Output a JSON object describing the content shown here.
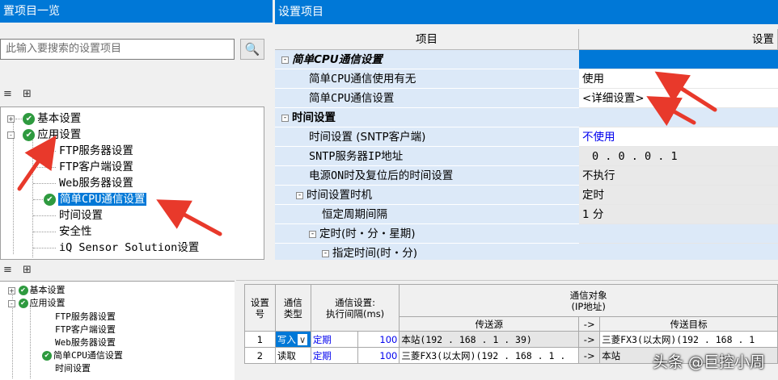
{
  "left_panel": {
    "title": "置项目一览",
    "search_placeholder": "此输入要搜索的设置项目",
    "search_icon": "binoculars-icon",
    "toolbar_icons": [
      "sort-icon",
      "tree-expand-icon"
    ],
    "tree": {
      "basic": "基本设置",
      "application": "应用设置",
      "children": [
        "FTP服务器设置",
        "FTP客户端设置",
        "Web服务器设置",
        "简单CPU通信设置",
        "时间设置",
        "安全性",
        "iQ Sensor Solution设置"
      ]
    }
  },
  "right_panel": {
    "title": "设置项目",
    "col_item": "项目",
    "col_setting": "设置",
    "rows": [
      {
        "name": "简单CPU通信设置",
        "value": ""
      },
      {
        "name": "简单CPU通信使用有无",
        "value": "使用"
      },
      {
        "name": "简单CPU通信设置",
        "value": "<详细设置>"
      },
      {
        "name": "时间设置",
        "value": ""
      },
      {
        "name": "时间设置 (SNTP客户端)",
        "value": "不使用"
      },
      {
        "name": "SNTP服务器IP地址",
        "value": "0 .  0 .  0 .  1"
      },
      {
        "name": "电源ON时及复位后的时间设置",
        "value": "不执行"
      },
      {
        "name": "时间设置时机",
        "value": "定时"
      },
      {
        "name": "恒定周期间隔",
        "value": "1 分"
      },
      {
        "name": "定时(时・分・星期)",
        "value": ""
      },
      {
        "name": "指定时间(时・分)",
        "value": ""
      }
    ]
  },
  "bottom_left": {
    "tree": {
      "basic": "基本设置",
      "application": "应用设置",
      "children": [
        "FTP服务器设置",
        "FTP客户端设置",
        "Web服务器设置",
        "简单CPU通信设置",
        "时间设置"
      ]
    }
  },
  "bottom_right": {
    "headers": {
      "setting_no": "设置\n号",
      "comm_type": "通信\n类型",
      "comm_setting": "通信设置:\n执行间隔(ms)",
      "target": "通信对象\n(IP地址)",
      "source": "传送源",
      "arrow": "->",
      "dest": "传送目标"
    },
    "rows": [
      {
        "no": "1",
        "type": "写入",
        "timing": "定期",
        "interval": "100",
        "source": "本站(192 . 168 .  1 . 39)",
        "arrow": "->",
        "dest": "三菱FX3(以太网)(192 . 168 .  1"
      },
      {
        "no": "2",
        "type": "读取",
        "timing": "定期",
        "interval": "100",
        "source": "三菱FX3(以太网)(192 . 168 .  1 .",
        "arrow": "->",
        "dest": "本站"
      }
    ]
  },
  "watermark": "头条 @巨控小周",
  "colors": {
    "selection": "#0078d7",
    "property_bg": "#dce9f8",
    "arrow": "#e8392b",
    "check": "#2e9a3f"
  }
}
